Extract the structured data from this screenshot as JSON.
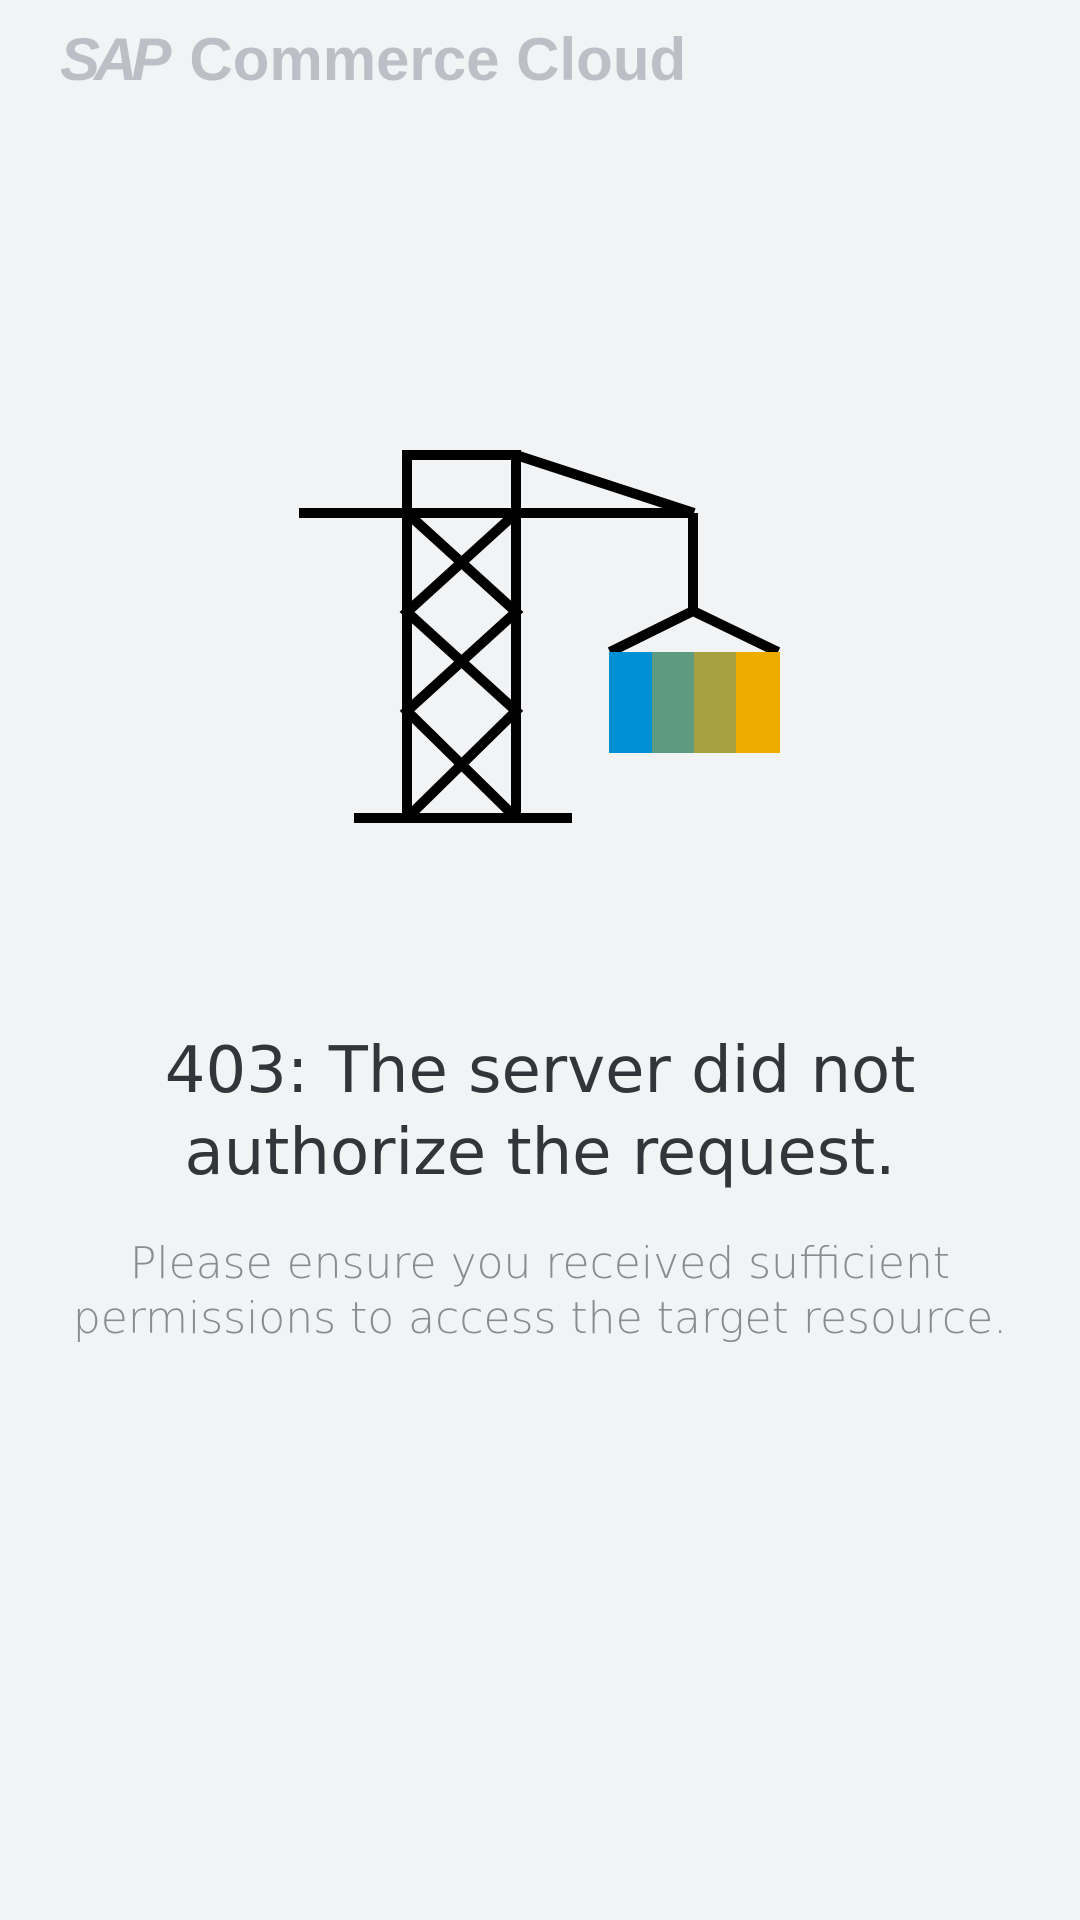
{
  "header": {
    "logo_text": "SAP",
    "product_name": "Commerce Cloud"
  },
  "illustration": {
    "icon": "crane-icon",
    "container_colors": [
      "#0091d5",
      "#5e9b7e",
      "#a8a141",
      "#eeab00"
    ]
  },
  "error": {
    "title_lines": [
      "403: The server did not",
      "authorize the request."
    ],
    "message_lines": [
      "Please ensure you received sufficient",
      "permissions to access the target resource."
    ]
  }
}
